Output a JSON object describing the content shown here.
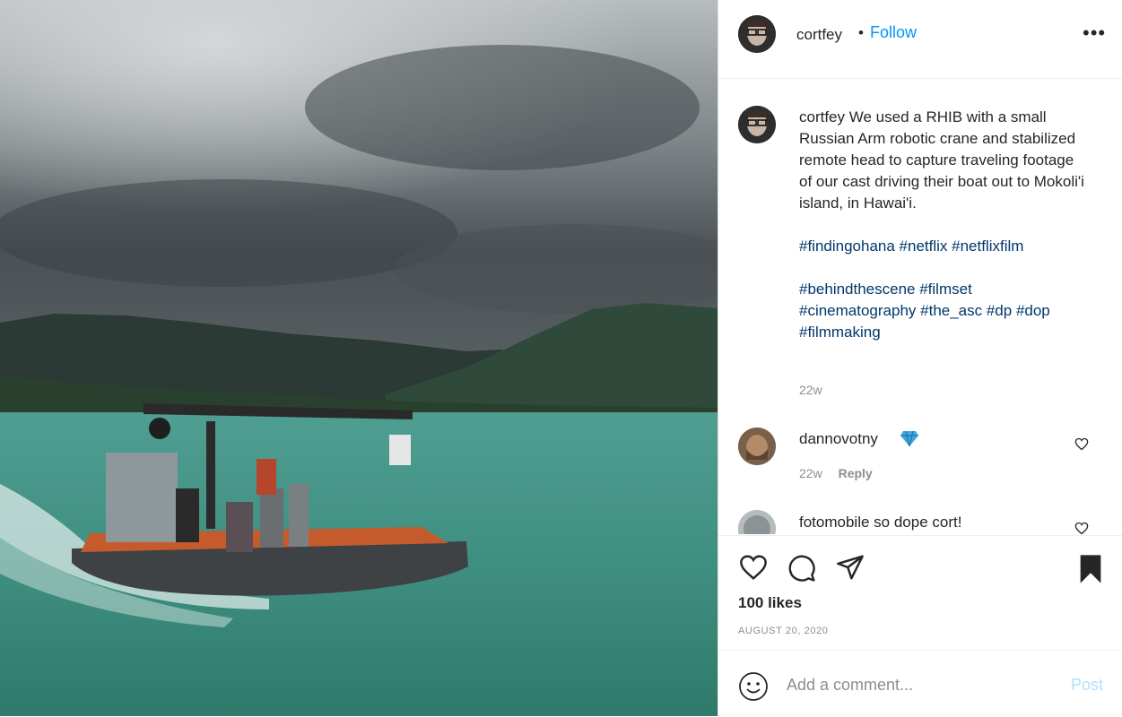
{
  "post": {
    "username": "cortfey",
    "separator": "•",
    "follow_label": "Follow",
    "more_label": "•••"
  },
  "caption": {
    "username": "cortfey",
    "text": "We used a RHIB with a small Russian Arm robotic crane and stabilized remote head to capture traveling footage of our cast driving their boat out to Mokoli'i island, in Hawai'i.",
    "tags_1": "#findingohana #netflix #netflixfilm",
    "tags_2": "#behindthescene #filmset #cinematography #the_asc #dp #dop #filmmaking",
    "age": "22w"
  },
  "comments": [
    {
      "username": "dannovotny",
      "badge": "diamond-icon",
      "age": "22w",
      "reply_label": "Reply"
    },
    {
      "username": "fotomobile",
      "text": "so dope cort!"
    }
  ],
  "actions": {
    "icons": [
      "heart-icon",
      "comment-icon",
      "share-icon",
      "bookmark-icon"
    ],
    "likes": "100 likes",
    "date": "AUGUST 20, 2020"
  },
  "add_comment": {
    "placeholder": "Add a comment...",
    "post_label": "Post"
  },
  "colors": {
    "link_blue": "#0095f6",
    "hashtag": "#00376b",
    "muted": "#8e8e8e",
    "post_disabled": "#b2dffc"
  }
}
